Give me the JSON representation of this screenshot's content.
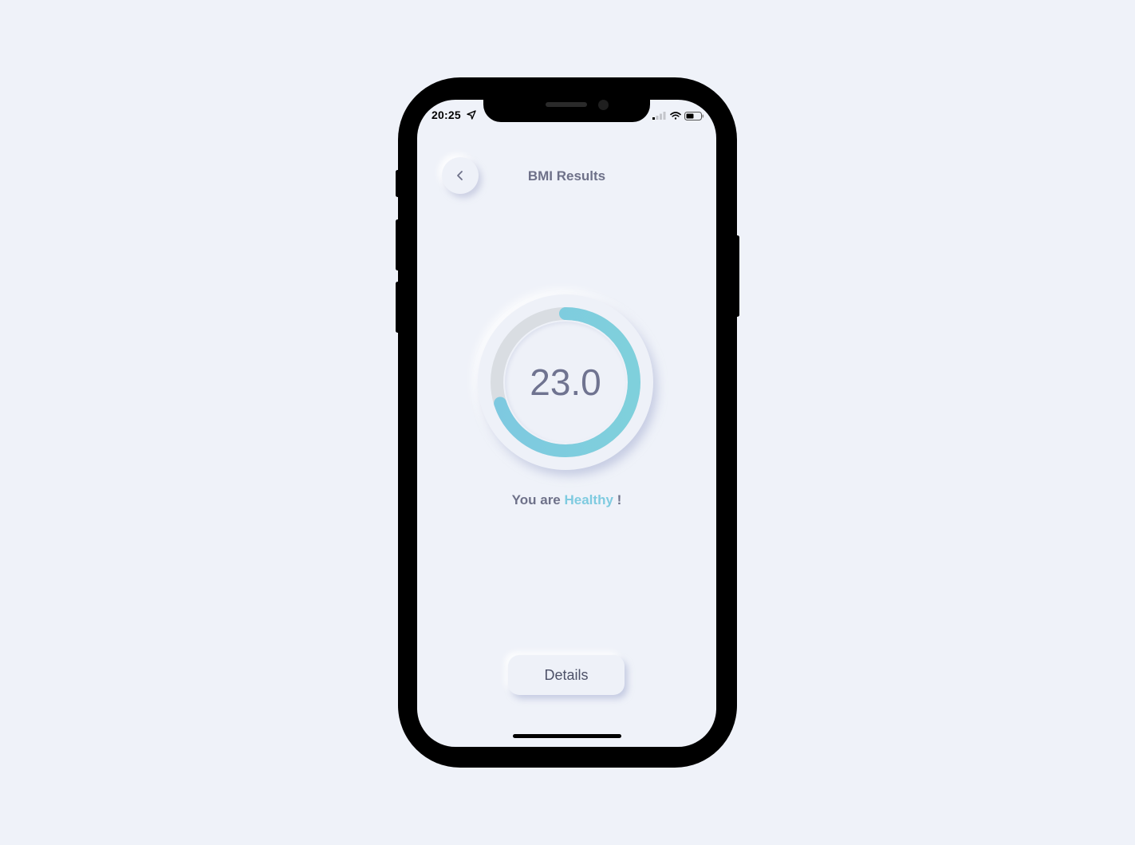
{
  "status_bar": {
    "time": "20:25",
    "location_icon": "location-arrow-icon",
    "signal_icon": "cellular-signal-icon",
    "wifi_icon": "wifi-icon",
    "battery_icon": "battery-icon"
  },
  "header": {
    "back_icon": "chevron-left-icon",
    "title": "BMI Results"
  },
  "result": {
    "bmi_value": "23.0",
    "gauge_progress": 0.7,
    "message_prefix": "You are",
    "status_word": "Healthy",
    "message_suffix": "!"
  },
  "actions": {
    "details_label": "Details"
  },
  "colors": {
    "background": "#eff2f9",
    "text": "#6e7189",
    "accent": "#7fcbe0",
    "track": "#d9dde2"
  }
}
